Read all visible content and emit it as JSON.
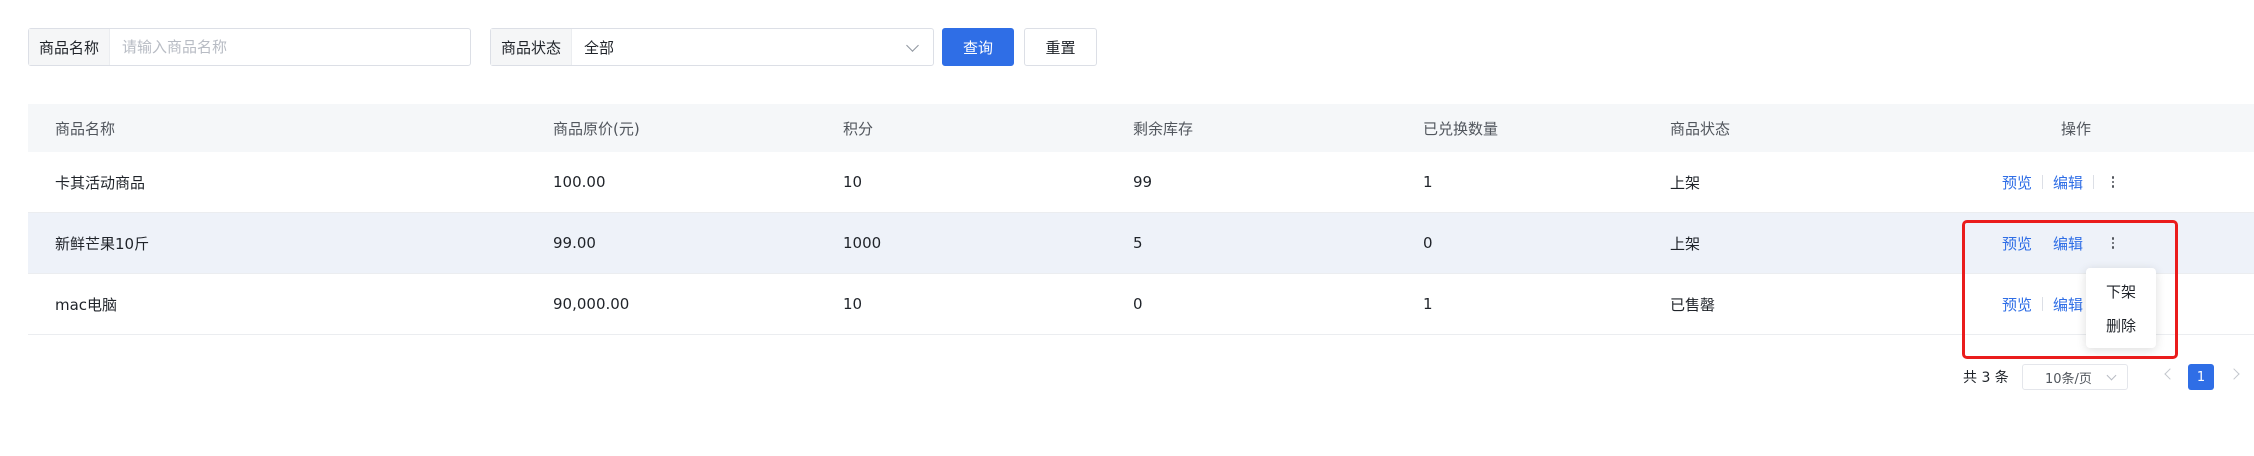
{
  "filters": {
    "name_label": "商品名称",
    "name_placeholder": "请输入商品名称",
    "status_label": "商品状态",
    "status_value": "全部",
    "query_button": "查询",
    "reset_button": "重置"
  },
  "table": {
    "columns": [
      "商品名称",
      "商品原价(元)",
      "积分",
      "剩余库存",
      "已兑换数量",
      "商品状态",
      "操作"
    ],
    "rows": [
      {
        "name": "卡其活动商品",
        "price": "100.00",
        "points": "10",
        "stock": "99",
        "exchanged": "1",
        "status": "上架",
        "preview": "预览",
        "edit": "编辑"
      },
      {
        "name": "新鲜芒果10斤",
        "price": "99.00",
        "points": "1000",
        "stock": "5",
        "exchanged": "0",
        "status": "上架",
        "preview": "预览",
        "edit": "编辑"
      },
      {
        "name": "mac电脑",
        "price": "90,000.00",
        "points": "10",
        "stock": "0",
        "exchanged": "1",
        "status": "已售罄",
        "preview": "预览",
        "edit": "编辑"
      }
    ]
  },
  "dropdown": {
    "items": [
      "下架",
      "删除"
    ]
  },
  "pagination": {
    "total": "共 3 条",
    "page_size": "10条/页",
    "current_page": "1"
  },
  "colors": {
    "primary": "#2f6ee6",
    "highlight": "#ea1c1c",
    "header_bg": "#f5f7f9",
    "hover_row_bg": "#eef2f9"
  },
  "icons": [
    "chevron-down-icon",
    "more-vertical-icon",
    "chevron-left-icon",
    "chevron-right-icon"
  ]
}
